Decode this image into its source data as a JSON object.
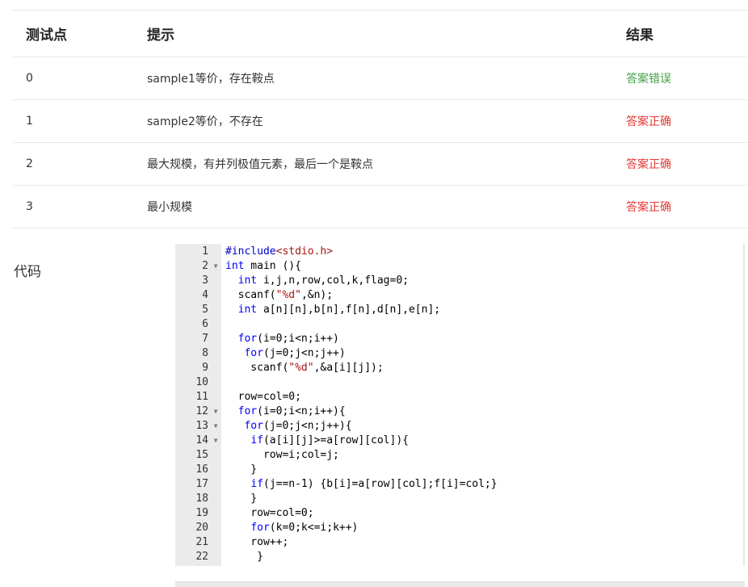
{
  "table": {
    "headers": {
      "id": "测试点",
      "hint": "提示",
      "result": "结果"
    },
    "rows": [
      {
        "id": "0",
        "hint": "sample1等价，存在鞍点",
        "result": "答案错误",
        "status": "wrong"
      },
      {
        "id": "1",
        "hint": "sample2等价，不存在",
        "result": "答案正确",
        "status": "right"
      },
      {
        "id": "2",
        "hint": "最大规模，有并列极值元素，最后一个是鞍点",
        "result": "答案正确",
        "status": "right"
      },
      {
        "id": "3",
        "hint": "最小规模",
        "result": "答案正确",
        "status": "right"
      }
    ],
    "colors": {
      "wrong": "#43a047",
      "right": "#e53935"
    }
  },
  "code": {
    "label": "代码",
    "lines": [
      {
        "n": "1",
        "fold": false,
        "text": "#include<stdio.h>"
      },
      {
        "n": "2",
        "fold": true,
        "text": "int main (){"
      },
      {
        "n": "3",
        "fold": false,
        "text": "  int i,j,n,row,col,k,flag=0;"
      },
      {
        "n": "4",
        "fold": false,
        "text": "  scanf(\"%d\",&n);"
      },
      {
        "n": "5",
        "fold": false,
        "text": "  int a[n][n],b[n],f[n],d[n],e[n];"
      },
      {
        "n": "6",
        "fold": false,
        "text": ""
      },
      {
        "n": "7",
        "fold": false,
        "text": "  for(i=0;i<n;i++)"
      },
      {
        "n": "8",
        "fold": false,
        "text": "   for(j=0;j<n;j++)"
      },
      {
        "n": "9",
        "fold": false,
        "text": "    scanf(\"%d\",&a[i][j]);"
      },
      {
        "n": "10",
        "fold": false,
        "text": ""
      },
      {
        "n": "11",
        "fold": false,
        "text": "  row=col=0;"
      },
      {
        "n": "12",
        "fold": true,
        "text": "  for(i=0;i<n;i++){"
      },
      {
        "n": "13",
        "fold": true,
        "text": "   for(j=0;j<n;j++){"
      },
      {
        "n": "14",
        "fold": true,
        "text": "    if(a[i][j]>=a[row][col]){"
      },
      {
        "n": "15",
        "fold": false,
        "text": "      row=i;col=j;"
      },
      {
        "n": "16",
        "fold": false,
        "text": "    }"
      },
      {
        "n": "17",
        "fold": false,
        "text": "    if(j==n-1) {b[i]=a[row][col];f[i]=col;}"
      },
      {
        "n": "18",
        "fold": false,
        "text": "    }"
      },
      {
        "n": "19",
        "fold": false,
        "text": "    row=col=0;"
      },
      {
        "n": "20",
        "fold": false,
        "text": "    for(k=0;k<=i;k++)"
      },
      {
        "n": "21",
        "fold": false,
        "text": "    row++;"
      },
      {
        "n": "22",
        "fold": false,
        "text": "     }"
      }
    ]
  }
}
